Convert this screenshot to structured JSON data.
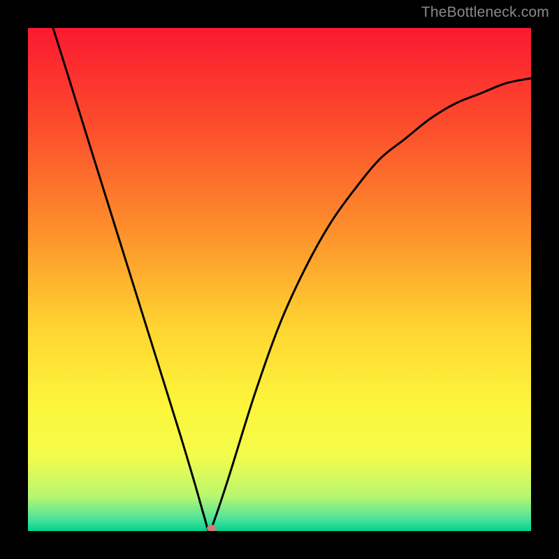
{
  "watermark": {
    "text": "TheBottleneck.com"
  },
  "colors": {
    "black": "#000000",
    "curve": "#000000",
    "marker": "#cb7f78",
    "gradient_stops": [
      {
        "offset": 0.0,
        "color": "#fb1930"
      },
      {
        "offset": 0.2,
        "color": "#fc4e2c"
      },
      {
        "offset": 0.4,
        "color": "#fd8f2b"
      },
      {
        "offset": 0.6,
        "color": "#fed631"
      },
      {
        "offset": 0.75,
        "color": "#fdf53b"
      },
      {
        "offset": 0.85,
        "color": "#f3fc4a"
      },
      {
        "offset": 0.93,
        "color": "#b8f76f"
      },
      {
        "offset": 0.975,
        "color": "#4fe39a"
      },
      {
        "offset": 1.0,
        "color": "#01d28e"
      }
    ]
  },
  "chart_data": {
    "type": "line",
    "title": "",
    "xlabel": "",
    "ylabel": "",
    "xlim": [
      0,
      100
    ],
    "ylim": [
      0,
      100
    ],
    "notes": "V-shaped bottleneck curve: percentage mismatch vs component balance. Minimum (0%) at x≈36; curve rises steeply to both sides. Marker dot shows the current configuration near the minimum.",
    "series": [
      {
        "name": "bottleneck-curve",
        "x": [
          0,
          5,
          10,
          15,
          20,
          25,
          30,
          33,
          35,
          36,
          37,
          40,
          45,
          50,
          55,
          60,
          65,
          70,
          75,
          80,
          85,
          90,
          95,
          100
        ],
        "values": [
          115,
          100,
          84,
          68,
          52,
          36,
          20,
          10,
          3,
          0,
          2,
          11,
          27,
          41,
          52,
          61,
          68,
          74,
          78,
          82,
          85,
          87,
          89,
          90
        ]
      }
    ],
    "marker": {
      "x": 36.5,
      "y": 0.5
    },
    "background": "vertical red→orange→yellow→green gradient (good at bottom)"
  }
}
